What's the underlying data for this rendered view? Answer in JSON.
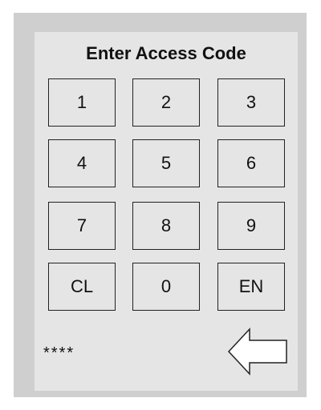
{
  "title": "Enter Access Code",
  "keypad": {
    "rows": [
      [
        "1",
        "2",
        "3"
      ],
      [
        "4",
        "5",
        "6"
      ],
      [
        "7",
        "8",
        "9"
      ],
      [
        "CL",
        "0",
        "EN"
      ]
    ]
  },
  "code_display": "****",
  "icons": {
    "back": "left-arrow-icon"
  },
  "colors": {
    "outer_bg": "#cfcfcf",
    "panel_bg": "#e5e5e5",
    "border": "#222222"
  }
}
